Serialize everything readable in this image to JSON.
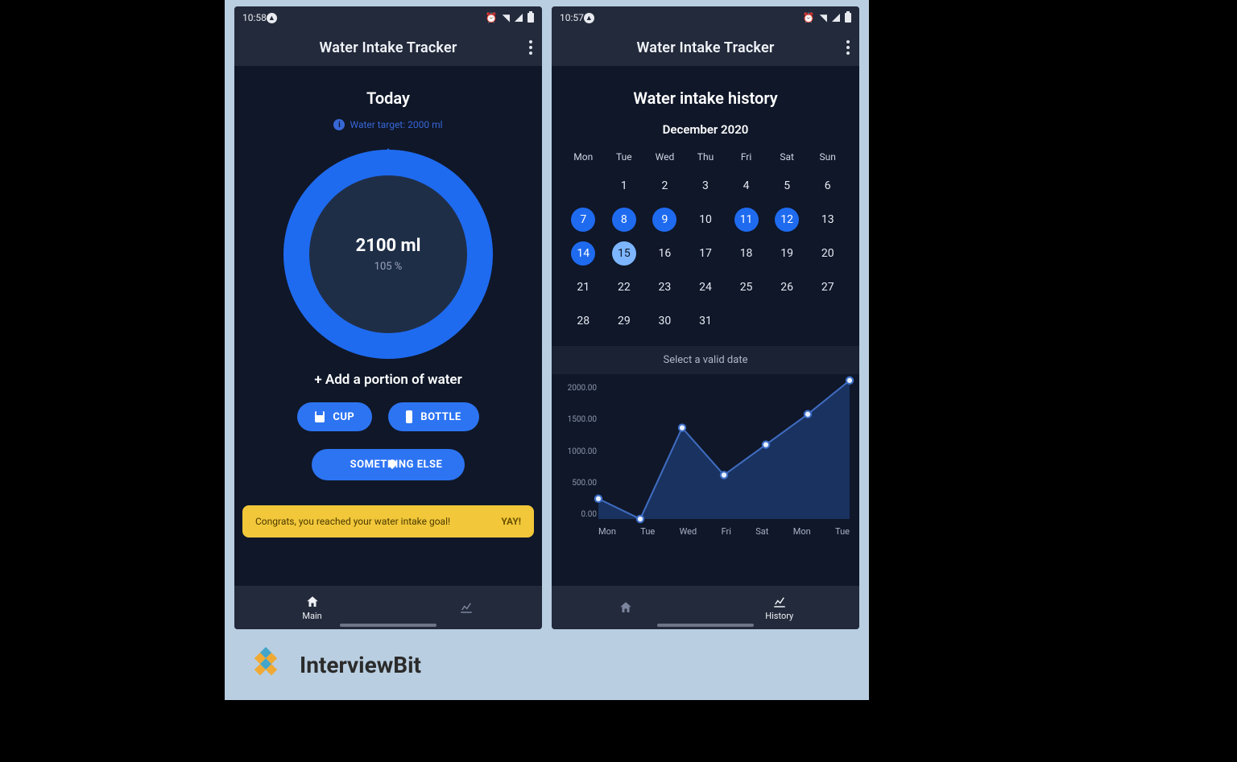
{
  "watermark": "InterviewBit",
  "screen1": {
    "status_time": "10:58",
    "app_title": "Water Intake Tracker",
    "today_title": "Today",
    "target_text": "Water target: 2000 ml",
    "intake_value": "2100 ml",
    "intake_pct": "105 %",
    "add_portion": "+ Add a portion of water",
    "btn_cup": "CUP",
    "btn_bottle": "BOTTLE",
    "btn_other": "SOMETHING ELSE",
    "toast_msg": "Congrats, you reached your water intake goal!",
    "toast_action": "YAY!",
    "nav_main": "Main",
    "nav_history": "History"
  },
  "screen2": {
    "status_time": "10:57",
    "app_title": "Water Intake Tracker",
    "history_title": "Water intake history",
    "month_label": "December 2020",
    "dow": [
      "Mon",
      "Tue",
      "Wed",
      "Thu",
      "Fri",
      "Sat",
      "Sun"
    ],
    "days": [
      {
        "d": "1"
      },
      {
        "d": "2"
      },
      {
        "d": "3"
      },
      {
        "d": "4"
      },
      {
        "d": "5"
      },
      {
        "d": "6"
      },
      {
        "d": "7",
        "s": "done"
      },
      {
        "d": "8",
        "s": "done"
      },
      {
        "d": "9",
        "s": "done"
      },
      {
        "d": "10"
      },
      {
        "d": "11",
        "s": "done"
      },
      {
        "d": "12",
        "s": "done"
      },
      {
        "d": "13"
      },
      {
        "d": "14",
        "s": "done"
      },
      {
        "d": "15",
        "s": "today"
      },
      {
        "d": "16"
      },
      {
        "d": "17"
      },
      {
        "d": "18"
      },
      {
        "d": "19"
      },
      {
        "d": "20"
      },
      {
        "d": "21"
      },
      {
        "d": "22"
      },
      {
        "d": "23"
      },
      {
        "d": "24"
      },
      {
        "d": "25"
      },
      {
        "d": "26"
      },
      {
        "d": "27"
      },
      {
        "d": "28"
      },
      {
        "d": "29"
      },
      {
        "d": "30"
      },
      {
        "d": "31"
      }
    ],
    "select_hint": "Select a valid date",
    "nav_main": "Main",
    "nav_history": "History"
  },
  "chart_data": {
    "type": "area",
    "title": "",
    "xlabel": "",
    "ylabel": "",
    "ylim": [
      0,
      2000
    ],
    "y_ticks": [
      "2000.00",
      "1500.00",
      "1000.00",
      "500.00",
      "0.00"
    ],
    "categories": [
      "Mon",
      "Tue",
      "Wed",
      "Fri",
      "Sat",
      "Mon",
      "Tue"
    ],
    "values": [
      300,
      0,
      1350,
      650,
      1100,
      1550,
      2050
    ]
  }
}
